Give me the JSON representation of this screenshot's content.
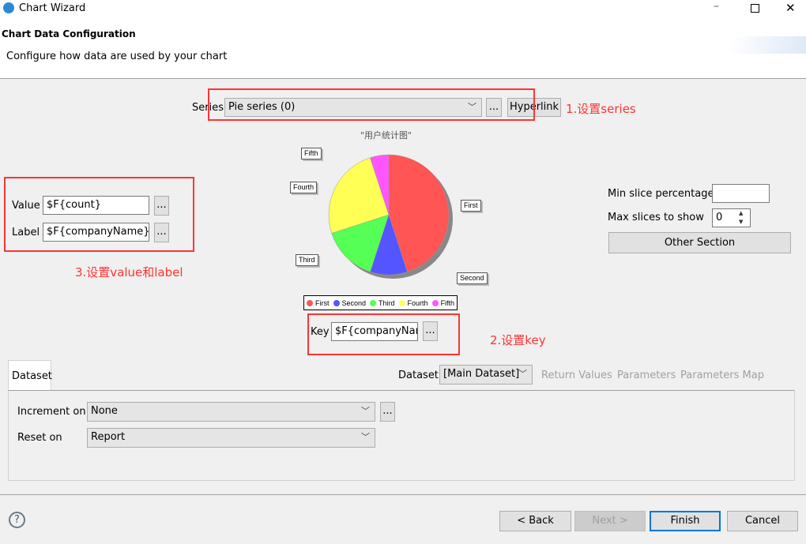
{
  "window": {
    "title": "Chart Wizard",
    "controls": [
      "minimize",
      "maximize",
      "close"
    ]
  },
  "header": {
    "title": "Chart Data Configuration",
    "subtitle": "Configure how data are used by your chart"
  },
  "series": {
    "label": "Series",
    "value": "Pie series (0)",
    "browse": "...",
    "hyperlink": "Hyperlink"
  },
  "annotations": {
    "series": "1.设置series",
    "key": "2.设置key",
    "value_label": "3.设置value和label"
  },
  "value": {
    "label": "Value",
    "value": "$F{count}",
    "browse": "..."
  },
  "labelfield": {
    "label": "Label",
    "value": "$F{companyName}",
    "browse": "..."
  },
  "key": {
    "label": "Key",
    "value": "$F{companyName}",
    "browse": "..."
  },
  "options": {
    "min_slice_label": "Min slice percentage",
    "min_slice_value": "",
    "max_slices_label": "Max slices to show",
    "max_slices_value": "0",
    "other_section": "Other Section"
  },
  "chart_data": {
    "type": "pie",
    "title": "\"用户统计图\"",
    "categories": [
      "First",
      "Second",
      "Third",
      "Fourth",
      "Fifth"
    ],
    "values": [
      45,
      10,
      15,
      25,
      5
    ],
    "colors": [
      "#ff5555",
      "#5555ff",
      "#55ff55",
      "#ffff55",
      "#ff55ff"
    ],
    "legend": "bottom"
  },
  "dataset_tab": {
    "tab": "Dataset",
    "dataset_label": "Dataset",
    "dataset_value": "[Main Dataset]",
    "return_values": "Return Values",
    "parameters": "Parameters",
    "parameters_map": "Parameters Map"
  },
  "increment": {
    "label": "Increment on",
    "value": "None",
    "browse": "..."
  },
  "reset": {
    "label": "Reset on",
    "value": "Report"
  },
  "footer": {
    "help": "?",
    "back": "< Back",
    "next": "Next >",
    "finish": "Finish",
    "cancel": "Cancel"
  }
}
